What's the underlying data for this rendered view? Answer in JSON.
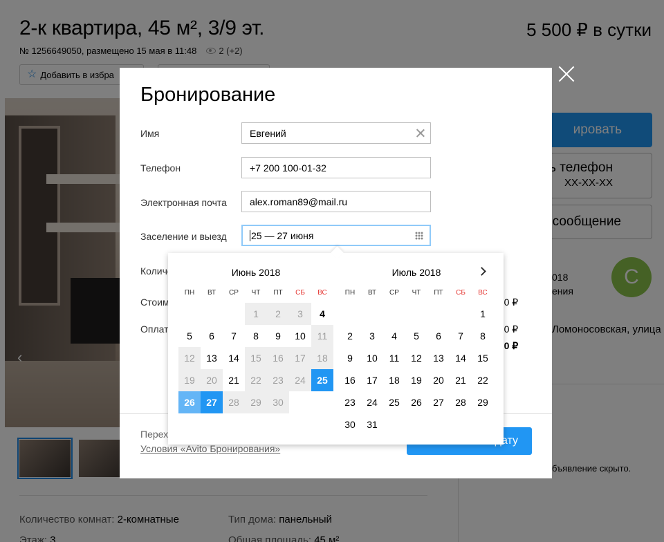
{
  "listing": {
    "title": "2-к квартира, 45 м², 3/9 эт.",
    "price": "5 500 ₽ в сутки",
    "meta": "№ 1256649050, размещено 15 мая в 11:48",
    "views": "2 (+2)",
    "favorite_label": "Добавить в избра",
    "props_left": [
      {
        "label": "Количество комнат: ",
        "value": "2-комнатные"
      },
      {
        "label": "Этаж: ",
        "value": "3"
      }
    ],
    "props_right": [
      {
        "label": "Тип дома: ",
        "value": "панельный"
      },
      {
        "label": "Общая площадь: ",
        "value": "45 м²"
      }
    ]
  },
  "sidebar": {
    "book_button": "ировать",
    "phone_line1": "ь телефон",
    "phone_line2": "XX-XX-XX",
    "message_button": "сообщение",
    "avatar_letter": "С",
    "seller_year": "018",
    "seller_note": "ения",
    "address": "Ломоносовская, улица",
    "hidden_note": "бъявление скрыто."
  },
  "modal": {
    "title": "Бронирование",
    "fields": {
      "name_label": "Имя",
      "name_value": "Евгений",
      "phone_label": "Телефон",
      "phone_value": "+7 200 100-01-32",
      "email_label": "Электронная почта",
      "email_value": "alex.roman89@mail.ru",
      "dates_label": "Заселение и выезд",
      "dates_value": "25 — 27 июня"
    },
    "partial_rows": {
      "guests_label": "Количе",
      "cost_label": "Стоим",
      "payment_label": "Оплат",
      "value1": "000 ₽",
      "value2": "000 ₽",
      "value3": "000 ₽"
    },
    "footer_text": "Перех",
    "footer_link": "Условия «Avito Бронирования»",
    "submit_label": "дату"
  },
  "calendar": {
    "weekdays": [
      "ПН",
      "ВТ",
      "СР",
      "ЧТ",
      "ПТ",
      "СБ",
      "ВС"
    ],
    "months": [
      {
        "title": "Июнь 2018",
        "offset": 3,
        "days": 30,
        "grey_days": [
          1,
          2,
          3,
          11,
          12,
          15,
          16,
          17,
          18,
          19,
          20,
          22,
          23,
          24,
          28,
          29,
          30
        ],
        "past_days": [],
        "bold_days": [
          4
        ],
        "selected_days": [
          25,
          27
        ],
        "range_days": [
          26
        ]
      },
      {
        "title": "Июль 2018",
        "offset": 6,
        "days": 31,
        "grey_days": [],
        "past_days": [],
        "bold_days": [],
        "selected_days": [],
        "range_days": []
      }
    ]
  }
}
